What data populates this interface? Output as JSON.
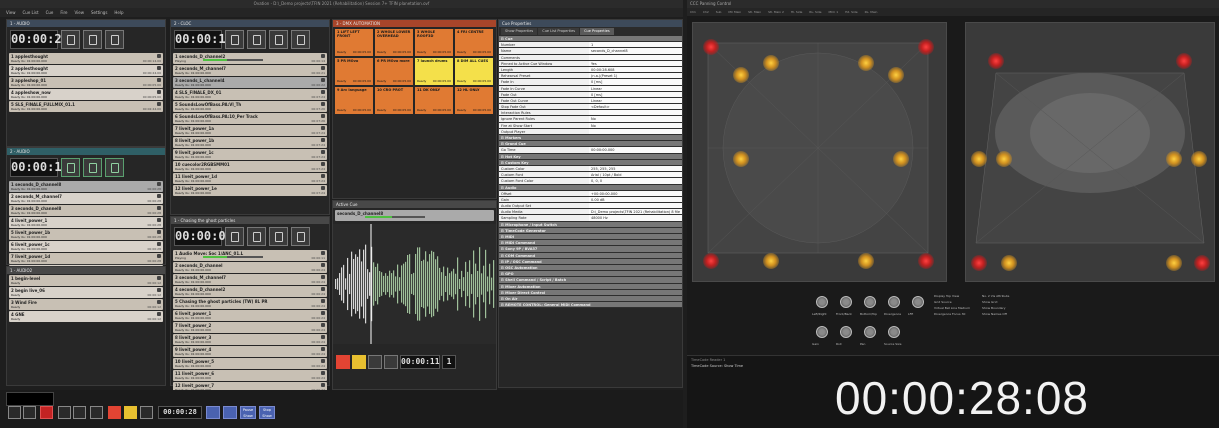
{
  "app": {
    "window_title": "Ovation - D:\\_Demo projects\\TFIN 2021 (Rehabilitation) Session 7+ TFIN planetation.ovf",
    "menu": [
      "View",
      "Cue List",
      "Cue",
      "Fire",
      "View",
      "Settings",
      "Help"
    ]
  },
  "panels": {
    "audio_panel": {
      "title": "1 - AUDIO",
      "timer": "00:00:28"
    },
    "cloc_panel": {
      "title": "2 - CLOC",
      "timer": "00:00:14"
    },
    "dmx_panel": {
      "title": "3 - DMX AUTOMATION"
    },
    "video_panel": {
      "title": "5 - VIDEO",
      "timer": "00:00:00"
    },
    "audio2_panel": {
      "title": "2 - AUDIO"
    },
    "chasing_panel": {
      "title": "1 - Chasing the ghost particles",
      "timer": "00:00:00"
    },
    "active_cue": {
      "title": "Active Cue"
    },
    "props_panel": {
      "title": "Cue Properties"
    }
  },
  "audio_cues": [
    {
      "name": "1  applesthought",
      "sub": "Ready      0s: 01:00:00.000",
      "time": "00:00:14.00"
    },
    {
      "name": "2  applesthought",
      "sub": "Ready      0s: 01:00:00.000",
      "time": "00:00:24.00"
    },
    {
      "name": "3  appleshop_01",
      "sub": "Ready      0s: 01:00:00.000",
      "time": "00:00:05.00"
    },
    {
      "name": "4  appleshow_now",
      "sub": "Ready      0s: 01:00:00.000",
      "time": "00:00:05.00"
    },
    {
      "name": "5  SLS_FINALE_FULLMIX_01.1",
      "sub": "Ready      0s: 01:00:00.000",
      "time": "00:02:44.00"
    }
  ],
  "cloc_cues": [
    {
      "name": "1  seconds_D_channel2",
      "sub": "Playing",
      "time": "00:00:14"
    },
    {
      "name": "2  seconds_M_channel7",
      "sub": "Ready      0s: 01:00:00.000",
      "time": "00:00:21"
    },
    {
      "name": "3  seconds_L_channel4",
      "sub": "Ready      0s: 01:00:00.000",
      "time": "00:00:22"
    },
    {
      "name": "4  SLS_FINALE_DX_01",
      "sub": "Ready      0s: 01:00:00.000",
      "time": "00:07:24"
    },
    {
      "name": "5  SoundsLowOfBass.PA:Vl_Th",
      "sub": "Ready      0s: 01:00:00.000",
      "time": "00:07:26"
    },
    {
      "name": "6  SoundsLowOfBass.PA:10_Per Track",
      "sub": "Ready      0s: 01:00:00.000",
      "time": "00:07:26"
    },
    {
      "name": "7  liveit_power_1a",
      "sub": "Ready      0s: 01:00:00.000",
      "time": "00:07:24"
    },
    {
      "name": "8  liveit_power_1b",
      "sub": "Ready      0s: 01:00:00.000",
      "time": "00:07:24"
    },
    {
      "name": "9  liveit_power_1c",
      "sub": "Ready      0s: 01:00:00.000",
      "time": "00:07:24"
    },
    {
      "name": "10  cuecolor2RGBSMM01",
      "sub": "Ready      0s: 01:00:00.000",
      "time": "00:07:24"
    },
    {
      "name": "11  liveit_power_1d",
      "sub": "Ready      0s: 01:00:00.000",
      "time": "00:07:24"
    },
    {
      "name": "12  liveit_power_1e",
      "sub": "Ready      0s: 01:00:00.000",
      "time": "00:07:24"
    }
  ],
  "audio2_cues": [
    {
      "name": "1  seconds_D_channel8",
      "sub": "Ready      0s: 01:00:00.000",
      "time": "00:00:28"
    },
    {
      "name": "2  seconds_M_channel7",
      "sub": "Ready      0s: 01:00:00.000",
      "time": "00:00:28"
    },
    {
      "name": "3  seconds_D_channel8",
      "sub": "Ready      0s: 01:00:00.000",
      "time": "00:00:28"
    },
    {
      "name": "4  liveit_power_1",
      "sub": "Ready      0s: 01:00:00.000",
      "time": "00:00:28"
    },
    {
      "name": "5  liveit_power_1b",
      "sub": "Ready      0s: 01:00:00.000",
      "time": "00:00:28"
    },
    {
      "name": "6  liveit_power_1c",
      "sub": "Ready      0s: 01:00:00.000",
      "time": "00:00:28"
    },
    {
      "name": "7  liveit_power_1d",
      "sub": "Ready      0s: 01:00:00.000",
      "time": "00:00:28"
    },
    {
      "name": "8  someARRSM04",
      "sub": "Ready      0s: 01:00:00.000",
      "time": "00:00:28"
    }
  ],
  "live_cues": [
    {
      "name": "1  begin-level",
      "sub": "Ready",
      "time": "00:00:12"
    },
    {
      "name": "2  begin live_06",
      "sub": "Ready",
      "time": "00:00:12"
    },
    {
      "name": "3  Wind Fire",
      "sub": "Ready",
      "time": "00:00:12"
    },
    {
      "name": "4  GNE",
      "sub": "Ready",
      "time": "00:00:12"
    }
  ],
  "chase_cues": [
    {
      "name": "1  Audio Move: Soc 1/ANC_01.L",
      "sub": "Playing",
      "time": "00:00:11"
    },
    {
      "name": "2  seconds_D_channel",
      "sub": "Ready      0s: 01:00:00.000",
      "time": "00:00:24"
    },
    {
      "name": "3  seconds_M_channel7",
      "sub": "Ready      0s: 01:00:00.000",
      "time": "00:00:24"
    },
    {
      "name": "4  seconds_D_channel2",
      "sub": "Ready      0s: 01:00:00.000",
      "time": "00:00:24"
    },
    {
      "name": "5  Chasing the ghost particles (TW) 8L PR",
      "sub": "Ready      0s: 01:00:00.000",
      "time": "00:00:24"
    },
    {
      "name": "6  liveit_power_1",
      "sub": "Ready      0s: 01:00:00.000",
      "time": "00:00:24"
    },
    {
      "name": "7  liveit_power_2",
      "sub": "Ready      0s: 01:00:00.000",
      "time": "00:00:24"
    },
    {
      "name": "8  liveit_power_3",
      "sub": "Ready      0s: 01:00:00.000",
      "time": "00:00:24"
    },
    {
      "name": "9  liveit_power_4",
      "sub": "Ready      0s: 01:00:00.000",
      "time": "00:00:24"
    },
    {
      "name": "10  liveit_power_5",
      "sub": "Ready      0s: 01:00:00.000",
      "time": "00:00:24"
    },
    {
      "name": "11  liveit_power_6",
      "sub": "Ready      0s: 01:00:00.000",
      "time": "00:00:24"
    },
    {
      "name": "12  liveit_power_7",
      "sub": "Ready      0s: 01:00:00.000",
      "time": "00:00:24"
    }
  ],
  "tiles": [
    {
      "label": "1  LIFT LEFT FRONT",
      "ready": "Ready",
      "time": "00:00:05.00",
      "selected": false
    },
    {
      "label": "2  WHOLE LOWER OVERHEAD",
      "ready": "Ready",
      "time": "00:00:05.00",
      "selected": false
    },
    {
      "label": "3  WHOLE ROOF3D",
      "ready": "Ready",
      "time": "00:00:05.00",
      "selected": false
    },
    {
      "label": "4  FRI CENTRE",
      "ready": "Ready",
      "time": "00:00:05.00",
      "selected": false
    },
    {
      "label": "5  PR MOvo",
      "ready": "Ready",
      "time": "00:00:05.00",
      "selected": false
    },
    {
      "label": "6  PR MOvo more",
      "ready": "Ready",
      "time": "00:00:05.00",
      "selected": false
    },
    {
      "label": "7  launch drums",
      "ready": "Ready",
      "time": "00:00:05.00",
      "selected": true
    },
    {
      "label": "8  DIM ALL CUES",
      "ready": "Ready",
      "time": "00:00:05.00",
      "selected": true
    },
    {
      "label": "9  Arc language",
      "ready": "Ready",
      "time": "00:00:05.00",
      "selected": false
    },
    {
      "label": "10  CRO PROT",
      "ready": "Ready",
      "time": "00:00:05.00",
      "selected": false
    },
    {
      "label": "11  DK ONLY",
      "ready": "Ready",
      "time": "00:00:05.00",
      "selected": false
    },
    {
      "label": "12  HL ONLY",
      "ready": "Ready",
      "time": "00:00:05.00",
      "selected": false
    }
  ],
  "active_cue_name": "seconds_D_channel8",
  "active_cue_time": "00:00:11",
  "active_cue_index": "1",
  "props_tabs": [
    "Show Properties",
    "Cue List Properties",
    "Cue Properties"
  ],
  "props": [
    {
      "k": "Cue",
      "v": "",
      "sec": true
    },
    {
      "k": "Number",
      "v": "1"
    },
    {
      "k": "Name",
      "v": "seconds_D_channel8"
    },
    {
      "k": "Comments",
      "v": ""
    },
    {
      "k": "Pinned to Active Cue Window",
      "v": "Yes"
    },
    {
      "k": "Length",
      "v": "00:00:28.608"
    },
    {
      "k": "Rehearsal Preset",
      "v": "(n.a.)(Preset 1)"
    },
    {
      "k": "Fade In",
      "v": "0 [ms]"
    },
    {
      "k": "Fade In Curve",
      "v": "Linear"
    },
    {
      "k": "Fade Out",
      "v": "0 [ms]"
    },
    {
      "k": "Fade Out Curve",
      "v": "Linear"
    },
    {
      "k": "Stop Fade Out",
      "v": "<Default>"
    },
    {
      "k": "Interaction Rules",
      "v": ""
    },
    {
      "k": "Ignore Parent Rules",
      "v": "No"
    },
    {
      "k": "Fire at Show Start",
      "v": "No"
    },
    {
      "k": "Output Player",
      "v": ""
    },
    {
      "k": "Markers",
      "v": "",
      "sec": true
    },
    {
      "k": "Grand Cue",
      "v": "",
      "sec": true
    },
    {
      "k": "Go Time",
      "v": "00:00:00.000"
    },
    {
      "k": "Hot Key",
      "v": "",
      "sec": true
    },
    {
      "k": "Custom Key",
      "v": "",
      "sec": true
    },
    {
      "k": "Custom Color",
      "v": "255, 255, 255"
    },
    {
      "k": "Custom Font",
      "v": "Arial / 10pt / Bold"
    },
    {
      "k": "Custom Font Color",
      "v": "0, 0, 0"
    },
    {
      "k": "Audio",
      "v": "",
      "sec": true
    },
    {
      "k": "Offset",
      "v": "+00:00:00.000"
    },
    {
      "k": "Gain",
      "v": "0.00 dB"
    },
    {
      "k": "Audio Output Set",
      "v": ""
    },
    {
      "k": "Audio Media",
      "v": "D:\\_Demo projects\\TFIN 2021 (Rehabilitation) 8 file movements\\Audio Files\\"
    },
    {
      "k": "Sampling Rate",
      "v": "48000 Hz"
    },
    {
      "k": "Microphone / Input Switch",
      "v": "",
      "sec": true
    },
    {
      "k": "TimeCode Generator",
      "v": "",
      "sec": true
    },
    {
      "k": "MIDI",
      "v": "",
      "sec": true
    },
    {
      "k": "MIDI Command",
      "v": "",
      "sec": true
    },
    {
      "k": "Sony 9P / BVA57",
      "v": "",
      "sec": true
    },
    {
      "k": "COM Command",
      "v": "",
      "sec": true
    },
    {
      "k": "IP / OSC Command",
      "v": "",
      "sec": true
    },
    {
      "k": "OSC Automation",
      "v": "",
      "sec": true
    },
    {
      "k": "GPO",
      "v": "",
      "sec": true
    },
    {
      "k": "Shell Command / Script / Batch",
      "v": "",
      "sec": true
    },
    {
      "k": "Mixer Automation",
      "v": "",
      "sec": true
    },
    {
      "k": "Mixer Direct Control",
      "v": "",
      "sec": true
    },
    {
      "k": "On Air",
      "v": "",
      "sec": true
    },
    {
      "k": "REMOTE CONTROL: General MIDI Command",
      "v": "",
      "sec": true
    }
  ],
  "spatial": {
    "title": "CCC Panning Control",
    "bigtime": "00:00:28:08",
    "tc_label": "TimeCode Reader 1",
    "tc_source": "TimeCode Source:  Show Time",
    "knobs_row1": [
      "Left/Right",
      "Front/Back",
      "Bottom/Top",
      "Divergence",
      "LFE"
    ],
    "knobs_row2": [
      "Gain",
      "Roll",
      "Pan",
      "Source Size"
    ],
    "side_labels": [
      {
        "label": "Display",
        "value": "Top View"
      },
      {
        "label": "Grid Source",
        "value": ""
      },
      {
        "label": "Virtual Bet Line",
        "value": "Medium"
      },
      {
        "label": "Divergence Focus",
        "value": "30"
      },
      {
        "label": "No. 2 Vis Attribute",
        "value": ""
      },
      {
        "label": "Show Grid",
        "value": ""
      },
      {
        "label": "Show Boundary",
        "value": ""
      },
      {
        "label": "Show Names",
        "value": "Off"
      }
    ],
    "speaker_groups": [
      "Ch1",
      "Ch2",
      "Sub",
      "MC Main",
      "Stl. Main",
      "Stl. Main 2",
      "Hl. Side",
      "RL. Side",
      "MCC 1",
      "Hd. Side",
      "RL. Main"
    ]
  },
  "transport": {
    "time": "00:00:28",
    "pause_label": "Pause Show",
    "stop_label": "Stop Show"
  }
}
